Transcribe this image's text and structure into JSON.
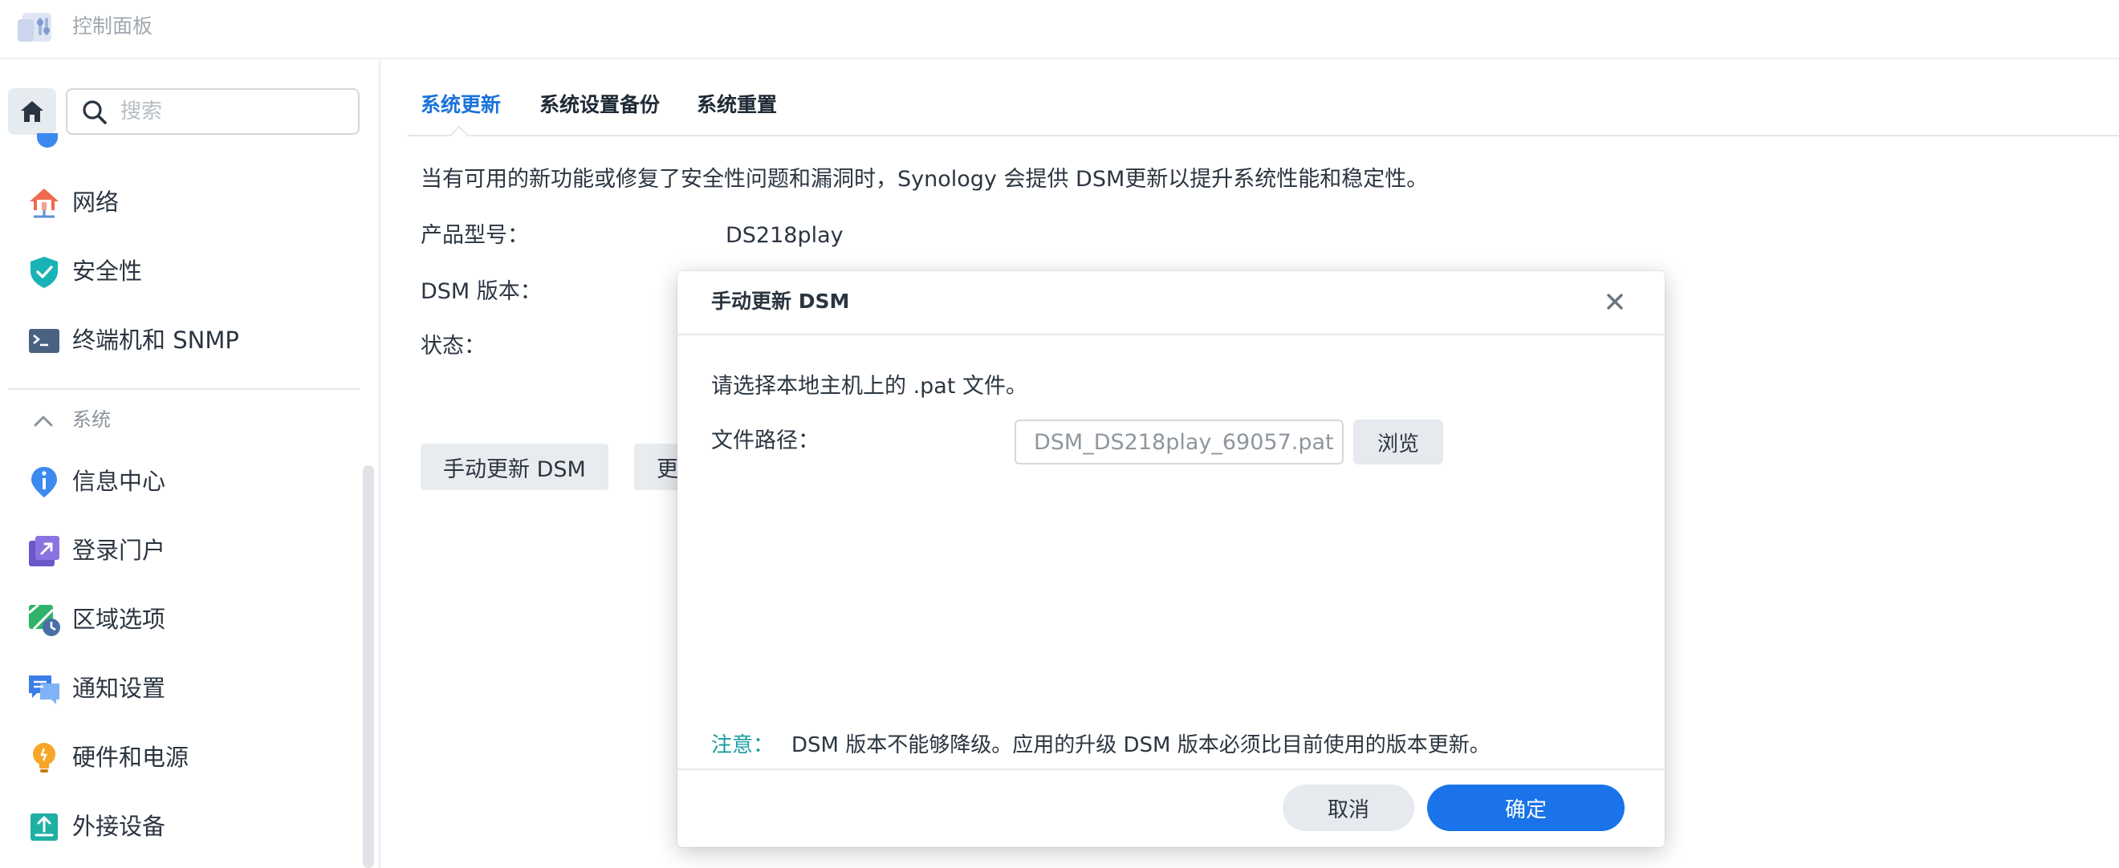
{
  "window": {
    "title": "控制面板"
  },
  "sidebar": {
    "search_placeholder": "搜索",
    "items_top": [
      {
        "label": "网络",
        "icon": "network-icon"
      },
      {
        "label": "安全性",
        "icon": "shield-icon"
      },
      {
        "label": "终端机和 SNMP",
        "icon": "terminal-icon"
      }
    ],
    "section": {
      "label": "系统",
      "icon": "chevron-up-icon"
    },
    "items_system": [
      {
        "label": "信息中心",
        "icon": "info-icon"
      },
      {
        "label": "登录门户",
        "icon": "login-portal-icon"
      },
      {
        "label": "区域选项",
        "icon": "regional-options-icon"
      },
      {
        "label": "通知设置",
        "icon": "notification-icon"
      },
      {
        "label": "硬件和电源",
        "icon": "bulb-icon"
      },
      {
        "label": "外接设备",
        "icon": "external-device-icon"
      }
    ]
  },
  "main": {
    "tabs": [
      {
        "label": "系统更新",
        "active": true
      },
      {
        "label": "系统设置备份",
        "active": false
      },
      {
        "label": "系统重置",
        "active": false
      }
    ],
    "description": "当有可用的新功能或修复了安全性问题和漏洞时，Synology 会提供 DSM更新以提升系统性能和稳定性。",
    "fields": {
      "model_label": "产品型号：",
      "model_value": "DS218play",
      "version_label": "DSM 版本：",
      "status_label": "状态："
    },
    "buttons": {
      "manual_update": "手动更新 DSM",
      "second_partial": "更"
    }
  },
  "dialog": {
    "title": "手动更新 DSM",
    "prompt": "请选择本地主机上的 .pat 文件。",
    "path_label": "文件路径：",
    "path_value": "DSM_DS218play_69057.pat",
    "browse_label": "浏览",
    "note_tag": "注意：",
    "note_text": "DSM 版本不能够降级。应用的升级 DSM 版本必须比目前使用的版本更新。",
    "cancel_label": "取消",
    "ok_label": "确定"
  },
  "colors": {
    "accent": "#1a73e8",
    "tab_active": "#1a73d9",
    "note_tag": "#1a9ca0",
    "text_primary": "#2b3541",
    "text_muted": "#a1a8b0"
  }
}
